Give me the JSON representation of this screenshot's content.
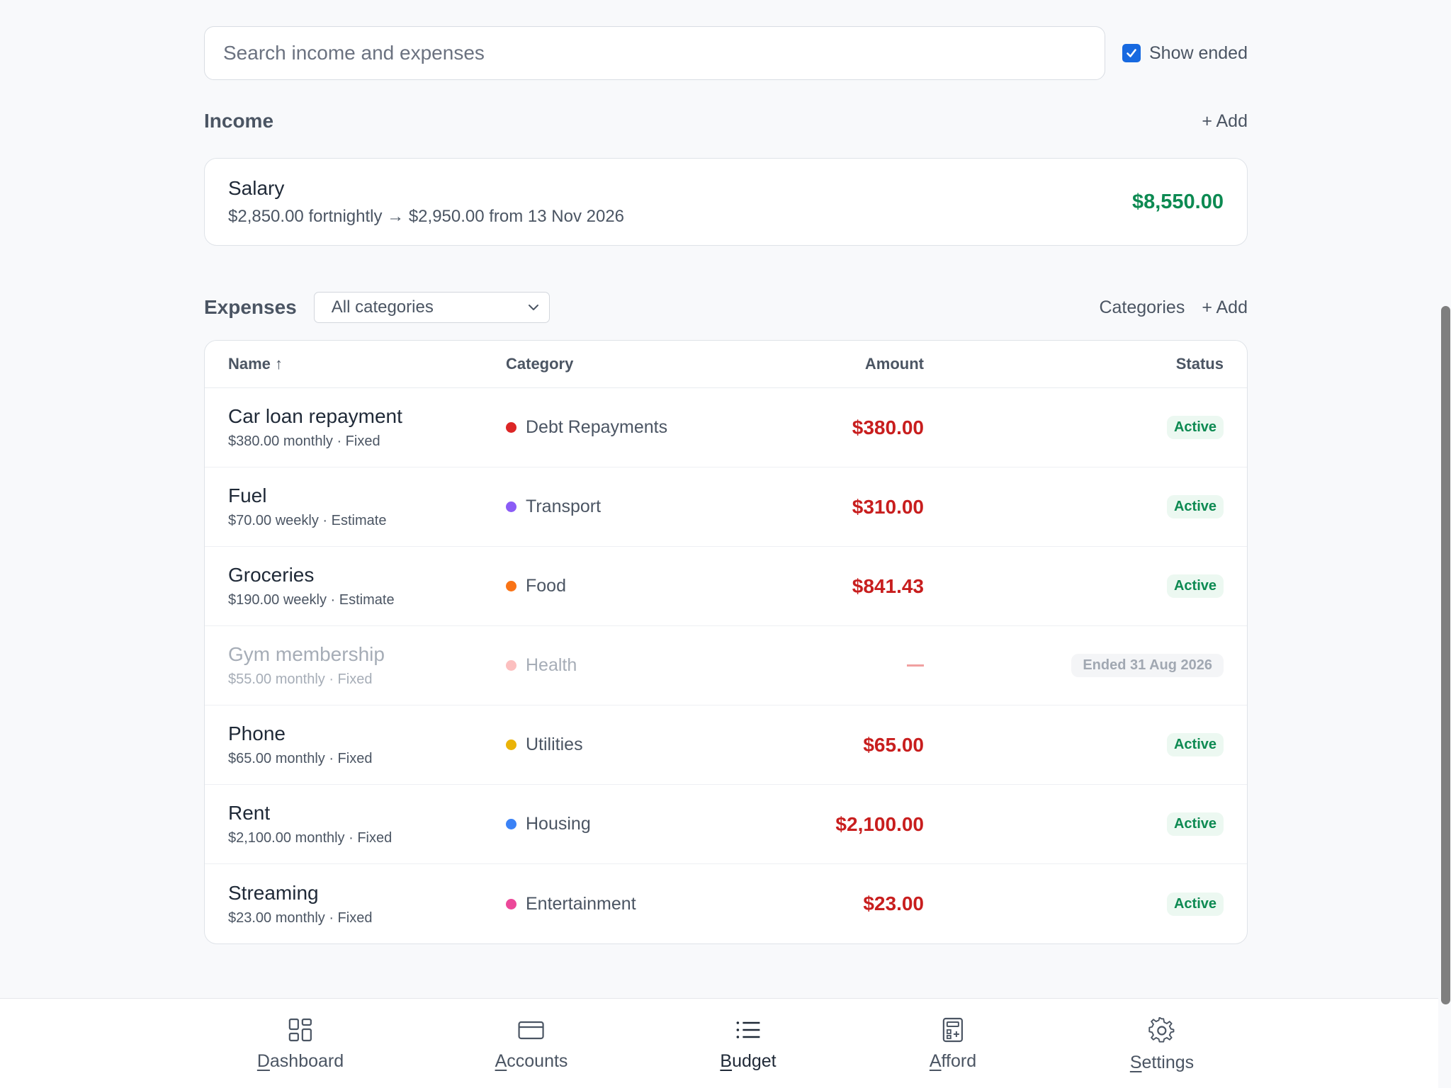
{
  "search": {
    "placeholder": "Search income and expenses",
    "show_ended_label": "Show ended",
    "show_ended_checked": true
  },
  "income": {
    "title": "Income",
    "add_label": "+ Add",
    "item": {
      "name": "Salary",
      "detail": "$2,850.00 fortnightly → $2,950.00 from 13 Nov 2026",
      "amount": "$8,550.00"
    }
  },
  "expenses": {
    "title": "Expenses",
    "category_filter": "All categories",
    "categories_link": "Categories",
    "add_label": "+ Add",
    "columns": {
      "name": "Name ↑",
      "category": "Category",
      "amount": "Amount",
      "status": "Status"
    },
    "rows": [
      {
        "name": "Car loan repayment",
        "sub": "$380.00 monthly · Fixed",
        "category": "Debt Repayments",
        "dot_color": "#dc2626",
        "amount": "$380.00",
        "status": "Active"
      },
      {
        "name": "Fuel",
        "sub": "$70.00 weekly · Estimate",
        "category": "Transport",
        "dot_color": "#8b5cf6",
        "amount": "$310.00",
        "status": "Active"
      },
      {
        "name": "Groceries",
        "sub": "$190.00 weekly · Estimate",
        "category": "Food",
        "dot_color": "#f97316",
        "amount": "$841.43",
        "status": "Active"
      },
      {
        "name": "Gym membership",
        "sub": "$55.00 monthly · Fixed",
        "category": "Health",
        "dot_color": "#f87171",
        "amount": "—",
        "status": "Ended 31 Aug 2026"
      },
      {
        "name": "Phone",
        "sub": "$65.00 monthly · Fixed",
        "category": "Utilities",
        "dot_color": "#eab308",
        "amount": "$65.00",
        "status": "Active"
      },
      {
        "name": "Rent",
        "sub": "$2,100.00 monthly · Fixed",
        "category": "Housing",
        "dot_color": "#3b82f6",
        "amount": "$2,100.00",
        "status": "Active"
      },
      {
        "name": "Streaming",
        "sub": "$23.00 monthly · Fixed",
        "category": "Entertainment",
        "dot_color": "#ec4899",
        "amount": "$23.00",
        "status": "Active"
      }
    ]
  },
  "nav": {
    "items": [
      {
        "label": "Dashboard",
        "icon": "dashboard-icon",
        "active": false
      },
      {
        "label": "Accounts",
        "icon": "card-icon",
        "active": false
      },
      {
        "label": "Budget",
        "icon": "list-icon",
        "active": true
      },
      {
        "label": "Afford",
        "icon": "calculator-icon",
        "active": false
      },
      {
        "label": "Settings",
        "icon": "gear-icon",
        "active": false
      }
    ]
  },
  "colors": {
    "income_amount": "#0d8a52",
    "expense_amount": "#c81e1e",
    "accent": "#1769e0"
  }
}
